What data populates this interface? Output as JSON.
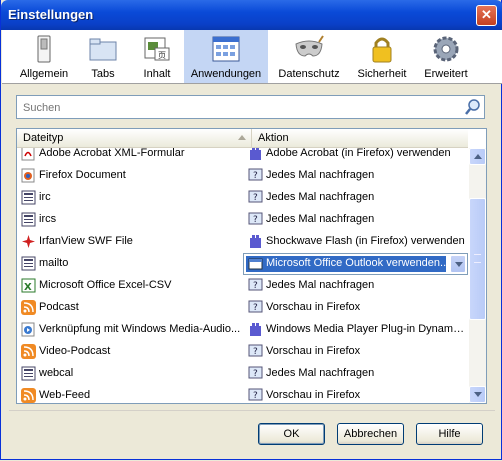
{
  "window": {
    "title": "Einstellungen",
    "close_glyph": "✕"
  },
  "toolbar": {
    "items": [
      {
        "label": "Allgemein",
        "icon": "switch-icon"
      },
      {
        "label": "Tabs",
        "icon": "folder-icon"
      },
      {
        "label": "Inhalt",
        "icon": "content-icon"
      },
      {
        "label": "Anwendungen",
        "icon": "applications-icon",
        "selected": true
      },
      {
        "label": "Datenschutz",
        "icon": "mask-icon"
      },
      {
        "label": "Sicherheit",
        "icon": "lock-icon"
      },
      {
        "label": "Erweitert",
        "icon": "gear-icon"
      }
    ]
  },
  "search": {
    "placeholder": "Suchen"
  },
  "list": {
    "columns": [
      "Dateityp",
      "Aktion"
    ],
    "rows": [
      {
        "type": "Adobe Acrobat XML-Formular",
        "action": "Adobe Acrobat (in Firefox) verwenden",
        "type_icon": "acrobat-icon",
        "action_icon": "plugin-icon"
      },
      {
        "type": "Firefox Document",
        "action": "Jedes Mal nachfragen",
        "type_icon": "firefox-icon",
        "action_icon": "ask-icon"
      },
      {
        "type": "irc",
        "action": "Jedes Mal nachfragen",
        "type_icon": "protocol-icon",
        "action_icon": "ask-icon"
      },
      {
        "type": "ircs",
        "action": "Jedes Mal nachfragen",
        "type_icon": "protocol-icon",
        "action_icon": "ask-icon"
      },
      {
        "type": "IrfanView SWF File",
        "action": "Shockwave Flash (in Firefox) verwenden",
        "type_icon": "irfanview-icon",
        "action_icon": "plugin-icon"
      },
      {
        "type": "mailto",
        "action": "Microsoft Office Outlook verwenden...",
        "type_icon": "protocol-icon",
        "action_icon": "outlook-icon",
        "selected": true
      },
      {
        "type": "Microsoft Office Excel-CSV",
        "action": "Jedes Mal nachfragen",
        "type_icon": "excel-icon",
        "action_icon": "ask-icon"
      },
      {
        "type": "Podcast",
        "action": "Vorschau in Firefox",
        "type_icon": "feed-icon",
        "action_icon": "ask-icon"
      },
      {
        "type": "Verknüpfung mit Windows Media-Audio...",
        "action": "Windows Media Player Plug-in Dynamic ...",
        "type_icon": "media-icon",
        "action_icon": "plugin-icon"
      },
      {
        "type": "Video-Podcast",
        "action": "Vorschau in Firefox",
        "type_icon": "feed-icon",
        "action_icon": "ask-icon"
      },
      {
        "type": "webcal",
        "action": "Jedes Mal nachfragen",
        "type_icon": "protocol-icon",
        "action_icon": "ask-icon"
      },
      {
        "type": "Web-Feed",
        "action": "Vorschau in Firefox",
        "type_icon": "feed-icon",
        "action_icon": "ask-icon"
      }
    ]
  },
  "buttons": {
    "ok": "OK",
    "cancel": "Abbrechen",
    "help": "Hilfe"
  },
  "colors": {
    "titlebar": "#0a4ad8",
    "selected_tab": "#c4d6f4",
    "selection": "#316ac5"
  }
}
